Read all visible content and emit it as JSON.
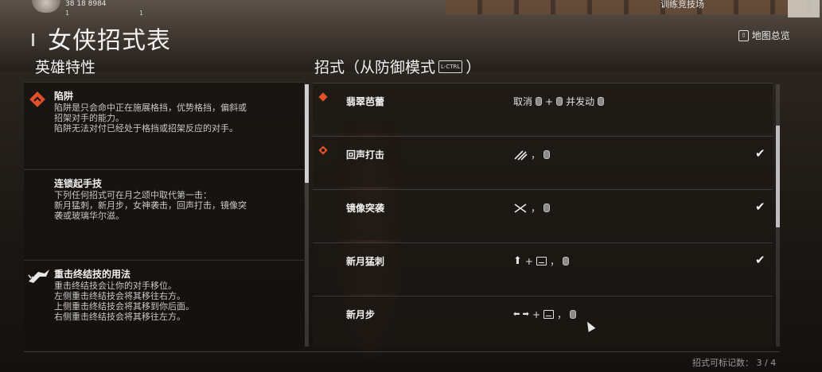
{
  "hud": {
    "stats": "38  18  8984",
    "sub_left": "1",
    "sub_right": "1",
    "top_right": "训练竞技场"
  },
  "title": "女侠招式表",
  "map_button": {
    "key": "⇧",
    "label": "地图总览"
  },
  "sections": {
    "left": "英雄特性",
    "right_prefix": "招式（从防御模式",
    "right_key": "L-CTRL",
    "right_suffix": "）"
  },
  "traits": [
    {
      "icon": "trap-icon",
      "name": "陷阱",
      "desc": "陷阱是只会命中正在施展格挡，优势格挡，偏斜或\n招架对手的能力。\n陷阱无法对付已经处于格挡或招架反应的对手。"
    },
    {
      "icon": "",
      "name": "连锁起手技",
      "desc": "下列任何招式可在月之颂中取代第一击：\n新月猛刺，新月步，女神袭击，回声打击，镜像突\n袭或玻璃华尔滋。"
    },
    {
      "icon": "heavy-finisher-icon",
      "name": "重击终结技的用法",
      "desc": "重击终结技会让你的对手移位。\n左侧重击终结技会将其移往右方。\n上侧重击终结技会将其移到你后面。\n右侧重击终结技会将其移往左方。"
    }
  ],
  "moves": [
    {
      "icon": "trap-icon",
      "name": "翡翠芭蕾",
      "input_text_1": "取消",
      "plus": "+",
      "input_text_2": "并发动",
      "checked": false
    },
    {
      "icon": "flame-icon",
      "name": "回声打击",
      "comma": "，",
      "checked": true,
      "check": "✔"
    },
    {
      "icon": "",
      "name": "镜像突袭",
      "comma": "，",
      "checked": true,
      "check": "✔"
    },
    {
      "icon": "",
      "name": "新月猛刺",
      "arrow": "⬆",
      "plus": "+",
      "comma": "，",
      "checked": true,
      "check": "✔"
    },
    {
      "icon": "",
      "name": "新月步",
      "arrow": "⬅ ➡",
      "plus": "+",
      "comma": "，",
      "checked": false
    }
  ],
  "footer": "招式可标记数：  3 / 4",
  "colors": {
    "accent": "#e0502a",
    "panel": "#1c1814",
    "text": "#f2f2f2"
  }
}
